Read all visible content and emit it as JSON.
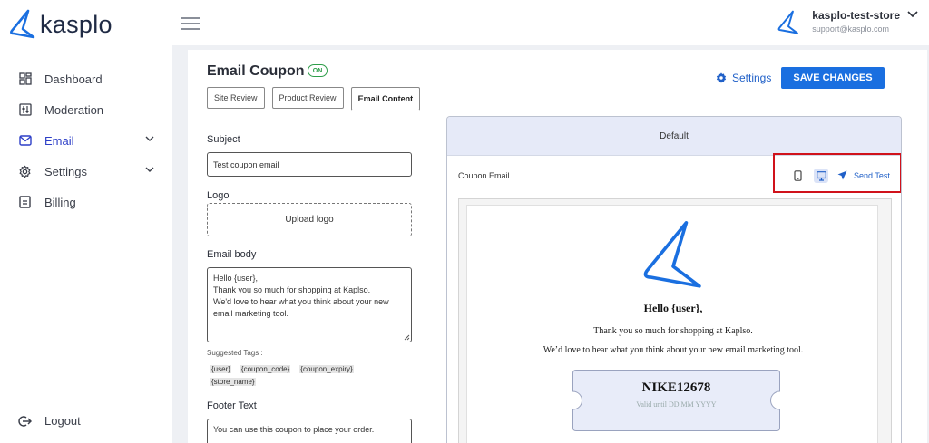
{
  "brand": {
    "name": "kasplo",
    "accent": "#1a6fe0"
  },
  "sidebar": {
    "items": [
      {
        "label": "Dashboard",
        "icon": "dashboard-icon"
      },
      {
        "label": "Moderation",
        "icon": "moderation-icon"
      },
      {
        "label": "Email",
        "icon": "mail-icon",
        "active": true,
        "expandable": true
      },
      {
        "label": "Settings",
        "icon": "gear-icon",
        "expandable": true
      },
      {
        "label": "Billing",
        "icon": "billing-icon"
      }
    ],
    "logout": "Logout"
  },
  "topbar": {
    "store_name": "kasplo-test-store",
    "store_email": "support@kasplo.com"
  },
  "page": {
    "title": "Email Coupon",
    "status_badge": "ON",
    "tabs": [
      {
        "label": "Site Review"
      },
      {
        "label": "Product Review"
      },
      {
        "label": "Email Content",
        "active": true
      }
    ],
    "settings_label": "Settings",
    "save_label": "SAVE CHANGES"
  },
  "form": {
    "subject_label": "Subject",
    "subject_value": "Test coupon email",
    "logo_label": "Logo",
    "upload_label": "Upload logo",
    "body_label": "Email body",
    "body_lines": [
      "Hello {user},",
      "Thank you so much for shopping at Kaplso.",
      "We'd love to hear what you think about your new",
      "email marketing tool."
    ],
    "tags_label": "Suggested Tags :",
    "tags": [
      "{user}",
      "{coupon_code}",
      "{coupon_expiry}",
      "{store_name}"
    ],
    "footer_label": "Footer Text",
    "footer_value": "You can use this coupon to place your order."
  },
  "preview": {
    "header": "Default",
    "template_name": "Coupon Email",
    "send_test": "Send Test",
    "email": {
      "greeting": "Hello {user},",
      "line1": "Thank you so much for shopping at Kaplso.",
      "line2": "We’d love to hear what you think about your new email marketing tool.",
      "coupon_code": "NIKE12678",
      "coupon_valid": "Valid until DD MM YYYY"
    }
  }
}
